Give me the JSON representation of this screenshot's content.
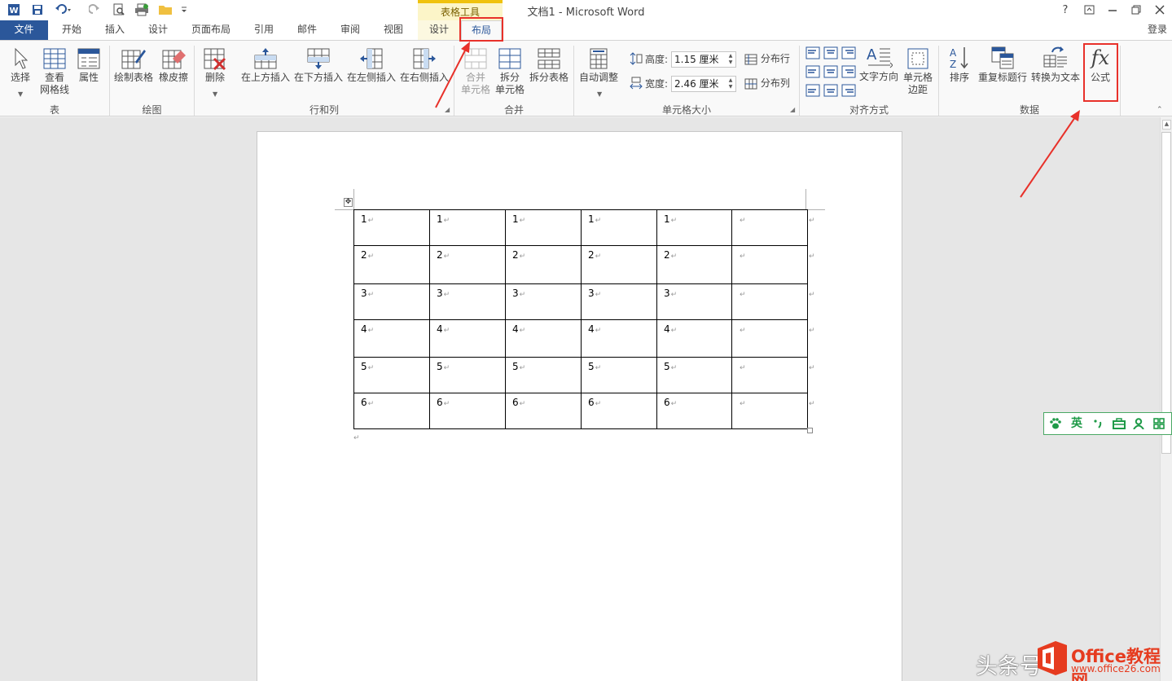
{
  "window": {
    "title": "文档1 - Microsoft Word",
    "context_tools_label": "表格工具",
    "help": "?",
    "login": "登录"
  },
  "quick_access": {
    "icons": [
      "word-app-icon",
      "save-icon",
      "undo-icon",
      "redo-icon",
      "print-preview-icon",
      "print-icon",
      "folder-icon",
      "customize-icon"
    ]
  },
  "tabs": [
    {
      "label": "文件"
    },
    {
      "label": "开始"
    },
    {
      "label": "插入"
    },
    {
      "label": "设计"
    },
    {
      "label": "页面布局"
    },
    {
      "label": "引用"
    },
    {
      "label": "邮件"
    },
    {
      "label": "审阅"
    },
    {
      "label": "视图"
    },
    {
      "label": "设计"
    },
    {
      "label": "布局"
    }
  ],
  "active_tab": "布局",
  "ribbon": {
    "select": "选择",
    "gridlines_1": "查看",
    "gridlines_2": "网格线",
    "properties": "属性",
    "draw_table": "绘制表格",
    "eraser": "橡皮擦",
    "delete": "删除",
    "insert_above": "在上方插入",
    "insert_below": "在下方插入",
    "insert_left": "在左侧插入",
    "insert_right": "在右侧插入",
    "merge_1": "合并",
    "merge_2": "单元格",
    "split_1": "拆分",
    "split_2": "单元格",
    "split_table": "拆分表格",
    "autofit": "自动调整",
    "height_label": "高度:",
    "height_value": "1.15 厘米",
    "width_label": "宽度:",
    "width_value": "2.46 厘米",
    "distribute_rows": "分布行",
    "distribute_cols": "分布列",
    "text_direction": "文字方向",
    "cell_margins_1": "单元格",
    "cell_margins_2": "边距",
    "sort": "排序",
    "repeat_header": "重复标题行",
    "convert_to_text": "转换为文本",
    "formula_icon_text": "fx",
    "formula": "公式",
    "groups": {
      "table": "表",
      "draw": "绘图",
      "rows_cols": "行和列",
      "merge": "合并",
      "cell_size": "单元格大小",
      "alignment": "对齐方式",
      "data": "数据"
    }
  },
  "table": {
    "rows": [
      [
        "1",
        "1",
        "1",
        "1",
        "1",
        ""
      ],
      [
        "2",
        "2",
        "2",
        "2",
        "2",
        ""
      ],
      [
        "3",
        "3",
        "3",
        "3",
        "3",
        ""
      ],
      [
        "4",
        "4",
        "4",
        "4",
        "4",
        ""
      ],
      [
        "5",
        "5",
        "5",
        "5",
        "5",
        ""
      ],
      [
        "6",
        "6",
        "6",
        "6",
        "6",
        ""
      ]
    ],
    "paragraph_mark": "↵"
  },
  "ime": {
    "items": [
      "paw-icon",
      "英",
      "punctuation-icon",
      "toolbox-icon",
      "user-icon",
      "grid-icon"
    ]
  },
  "watermark": {
    "text1": "头条号",
    "text2": "Office教程网",
    "text3": "www.office26.com"
  },
  "colors": {
    "file_tab": "#2b579a",
    "highlight_box": "#e8312a",
    "arrow": "#e8312a",
    "tools_band": "#f0c20d"
  }
}
